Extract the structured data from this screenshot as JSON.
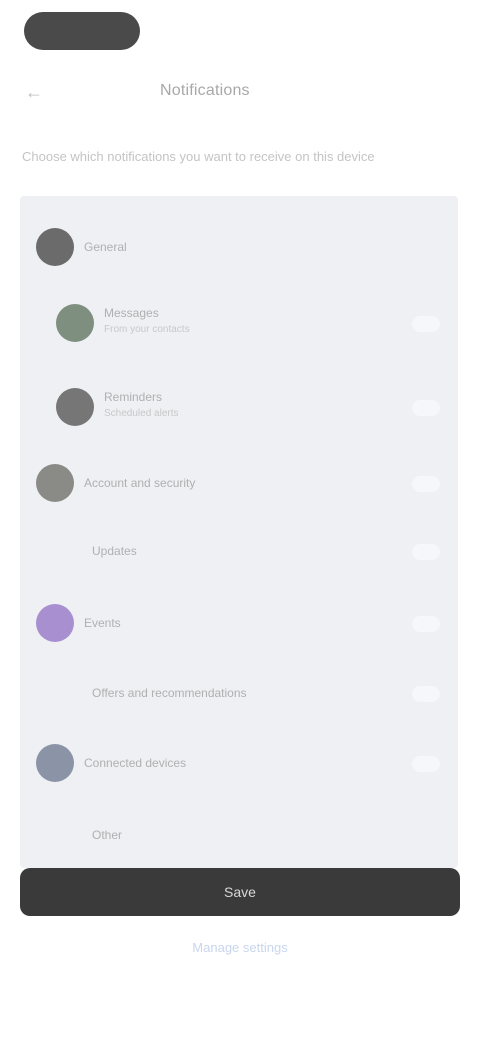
{
  "header": {
    "title": "Notifications",
    "back_icon": "arrow-left-icon"
  },
  "description": "Choose which notifications you want to receive on this device",
  "list": {
    "items": [
      {
        "label": "General",
        "sublabel": "",
        "avatar_color": "#6b6b6b",
        "toggle": false
      },
      {
        "label": "Messages",
        "sublabel": "From your contacts",
        "avatar_color": "#7f8f7f",
        "toggle": true
      },
      {
        "label": "Reminders",
        "sublabel": "Scheduled alerts",
        "avatar_color": "#767676",
        "toggle": true
      },
      {
        "label": "Account and security",
        "sublabel": "",
        "avatar_color": "#8a8a86",
        "toggle": true
      },
      {
        "label": "Updates",
        "sublabel": "",
        "avatar_color": "",
        "toggle": true
      },
      {
        "label": "Events",
        "sublabel": "",
        "avatar_color": "#a88fd0",
        "toggle": true
      },
      {
        "label": "Offers and recommendations",
        "sublabel": "",
        "avatar_color": "",
        "toggle": true
      },
      {
        "label": "Connected devices",
        "sublabel": "",
        "avatar_color": "#8a94a6",
        "toggle": true
      },
      {
        "label": "Other",
        "sublabel": "",
        "avatar_color": "",
        "toggle": false
      }
    ]
  },
  "actions": {
    "primary_label": "Save",
    "link_label": "Manage settings"
  }
}
